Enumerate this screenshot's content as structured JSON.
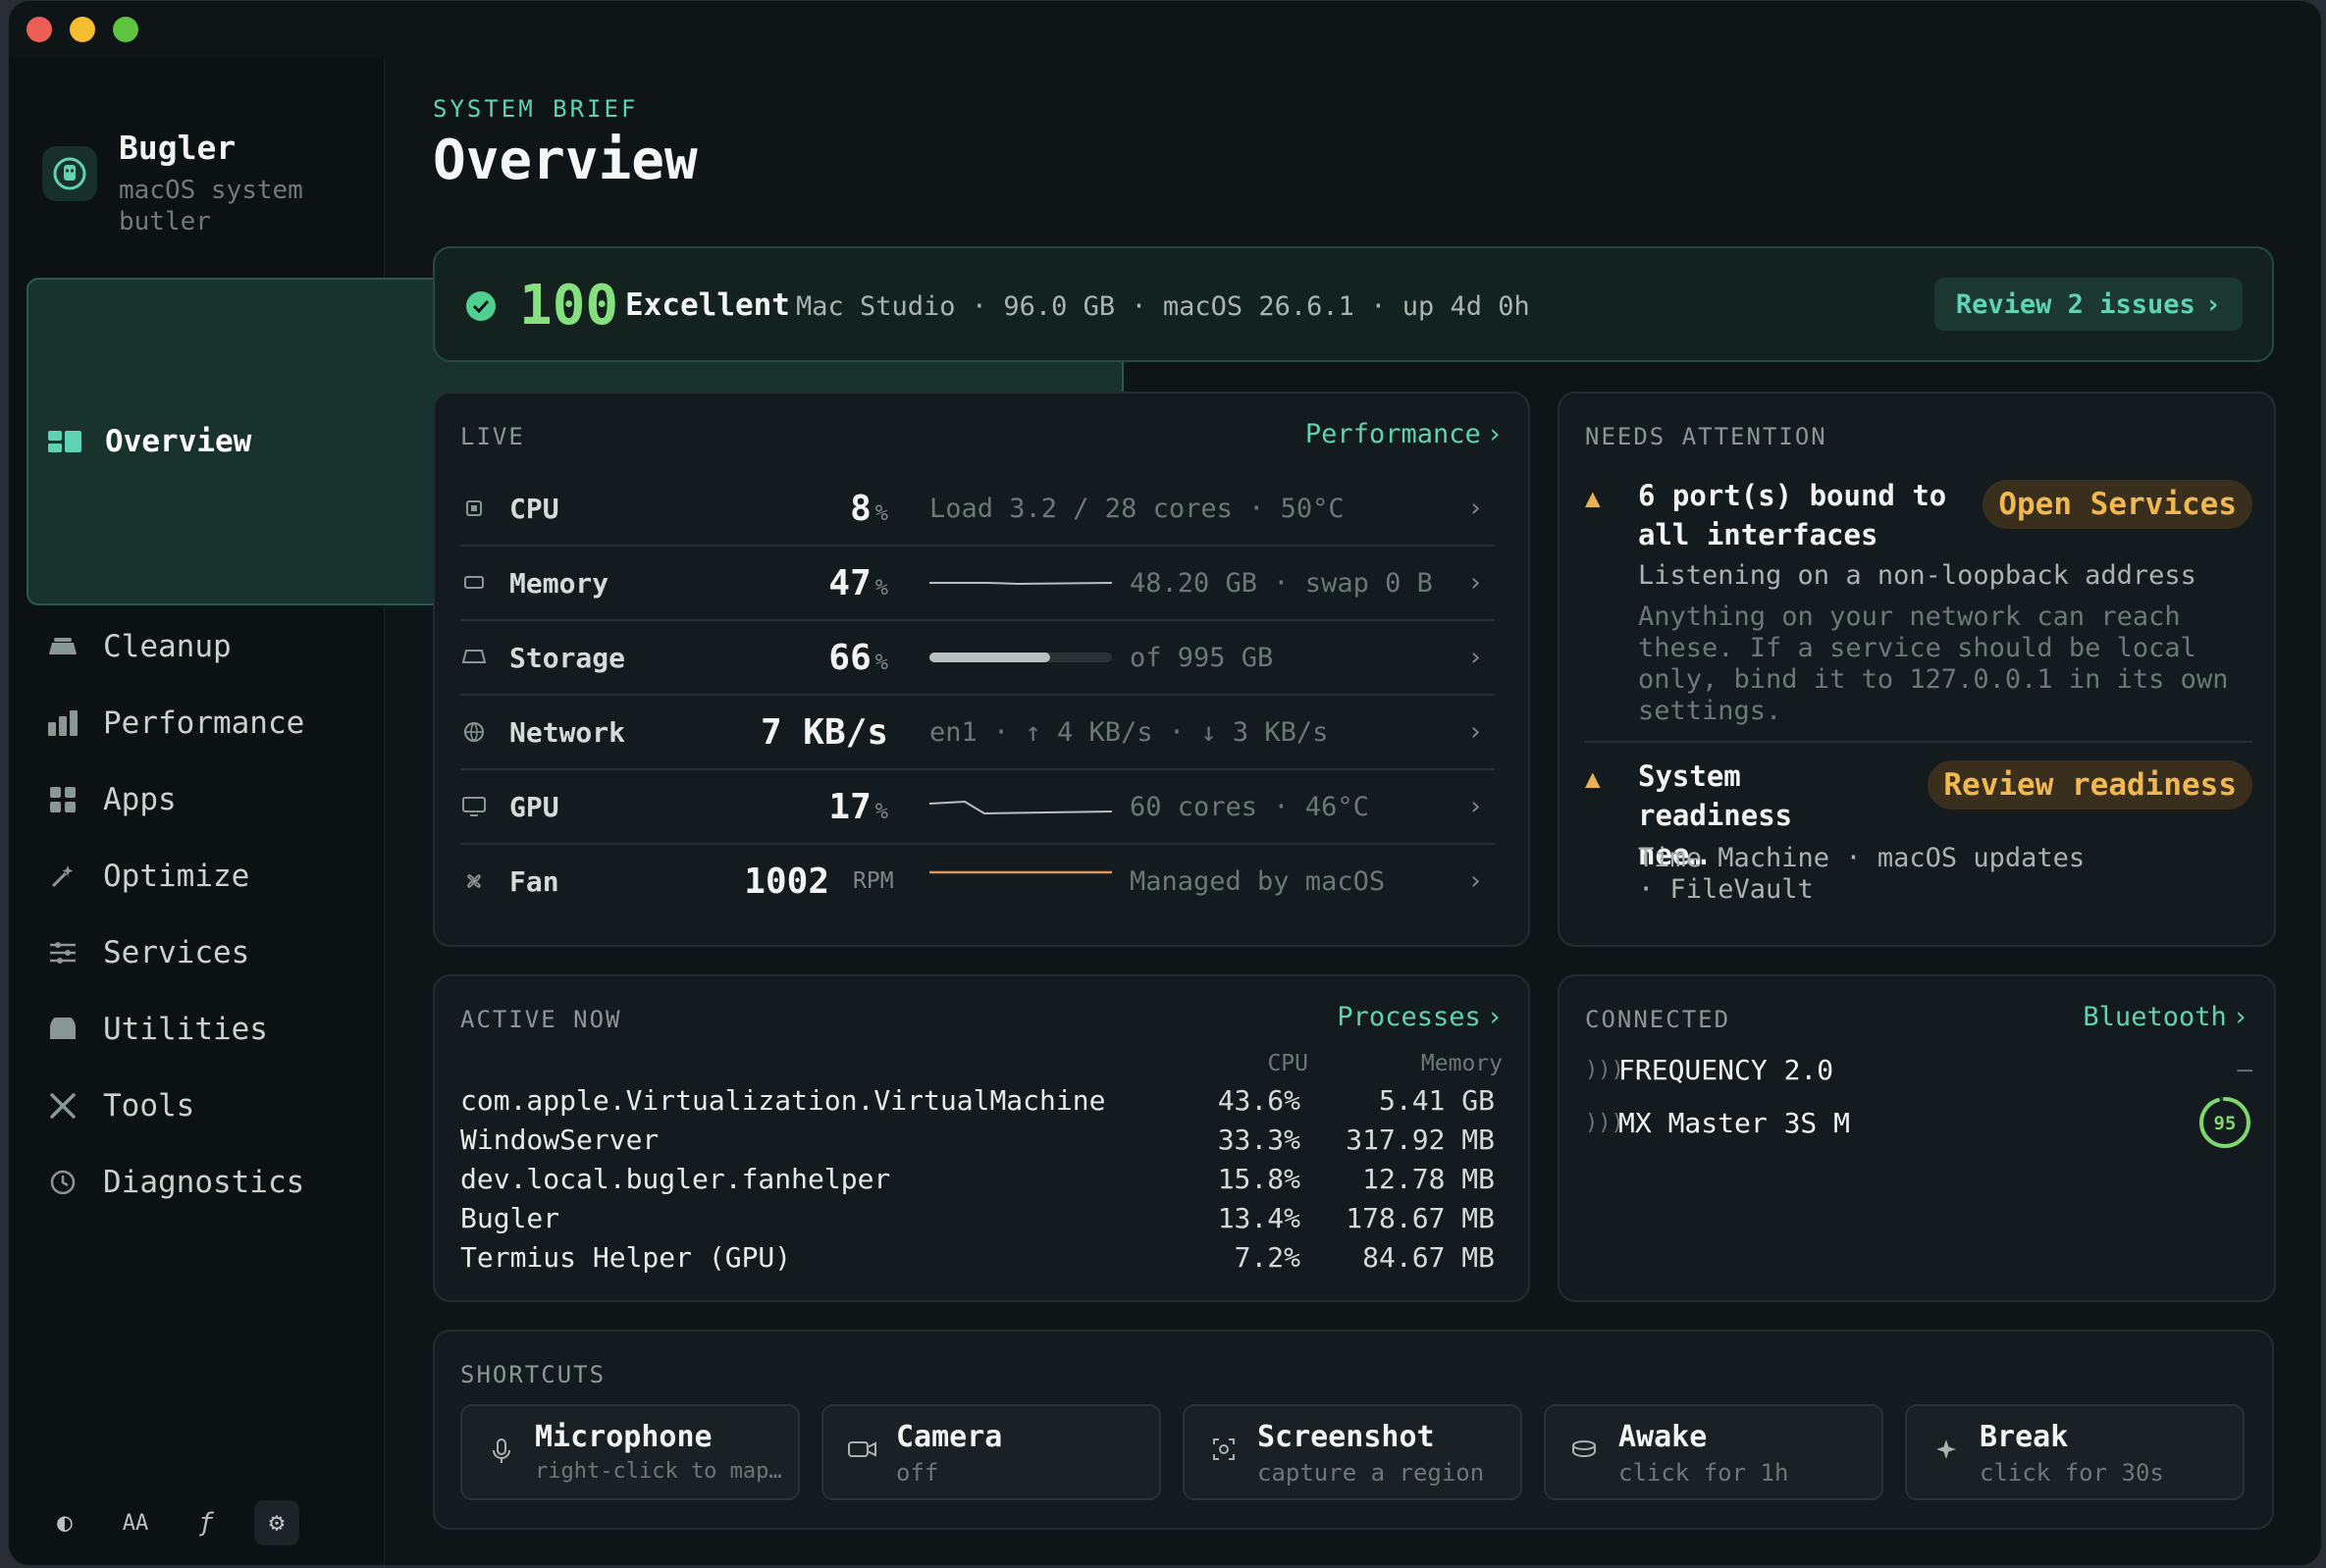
{
  "app": {
    "name": "Bugler",
    "subtitle_line1": "macOS system",
    "subtitle_line2": "butler"
  },
  "nav": [
    {
      "label": "Overview",
      "icon": "overview-icon",
      "active": true
    },
    {
      "label": "Cleanup",
      "icon": "cleanup-icon"
    },
    {
      "label": "Performance",
      "icon": "performance-icon"
    },
    {
      "label": "Apps",
      "icon": "apps-icon"
    },
    {
      "label": "Optimize",
      "icon": "optimize-icon"
    },
    {
      "label": "Services",
      "icon": "services-icon"
    },
    {
      "label": "Utilities",
      "icon": "utilities-icon"
    },
    {
      "label": "Tools",
      "icon": "tools-icon"
    },
    {
      "label": "Diagnostics",
      "icon": "diagnostics-icon"
    }
  ],
  "sidebar_footer": [
    "contrast-icon",
    "text-size-icon",
    "function-icon",
    "gear-icon"
  ],
  "header": {
    "eyebrow": "SYSTEM BRIEF",
    "title": "Overview"
  },
  "health": {
    "score": "100",
    "grade": "Excellent",
    "meta": "Mac Studio · 96.0 GB · macOS 26.6.1 · up 4d 0h",
    "action": "Review 2 issues",
    "score_color": "#86e07f"
  },
  "live": {
    "label": "LIVE",
    "link": "Performance",
    "metrics": [
      {
        "name": "CPU",
        "value": "8",
        "unit": "%",
        "detail": "Load 3.2 / 28 cores · 50°C"
      },
      {
        "name": "Memory",
        "value": "47",
        "unit": "%",
        "detail": "48.20 GB · swap 0 B"
      },
      {
        "name": "Storage",
        "value": "66",
        "unit": "%",
        "detail": "of 995 GB",
        "fill": 0.66
      },
      {
        "name": "Network",
        "value": "7 KB/s",
        "unit": "",
        "detail": "en1 · ↑ 4 KB/s · ↓ 3 KB/s"
      },
      {
        "name": "GPU",
        "value": "17",
        "unit": "%",
        "detail": "60 cores · 46°C"
      },
      {
        "name": "Fan",
        "value": "1002",
        "unit": "RPM",
        "detail": "Managed by macOS"
      }
    ]
  },
  "attention": {
    "label": "NEEDS ATTENTION",
    "items": [
      {
        "title": "6 port(s) bound to all interfaces",
        "action": "Open Services",
        "subtitle": "Listening on a non-loopback address",
        "description": "Anything on your network can reach these. If a service should be local only, bind it to 127.0.0.1 in its own settings."
      },
      {
        "title": "System readiness nee…",
        "action": "Review readiness",
        "subtitle": "Time Machine · macOS updates · FileVault"
      }
    ],
    "warn_color": "#e7b256"
  },
  "active": {
    "label": "ACTIVE NOW",
    "link": "Processes",
    "col_cpu": "CPU",
    "col_mem": "Memory",
    "processes": [
      {
        "name": "com.apple.Virtualization.VirtualMachine",
        "cpu": "43.6%",
        "mem": "5.41 GB"
      },
      {
        "name": "WindowServer",
        "cpu": "33.3%",
        "mem": "317.92 MB"
      },
      {
        "name": "dev.local.bugler.fanhelper",
        "cpu": "15.8%",
        "mem": "12.78 MB"
      },
      {
        "name": "Bugler",
        "cpu": "13.4%",
        "mem": "178.67 MB"
      },
      {
        "name": "Termius Helper (GPU)",
        "cpu": "7.2%",
        "mem": "84.67 MB"
      }
    ]
  },
  "connected": {
    "label": "CONNECTED",
    "link": "Bluetooth",
    "devices": [
      {
        "name": "FREQUENCY 2.0",
        "value": "—"
      },
      {
        "name": "MX Master 3S M",
        "battery": "95",
        "battery_level": 0.95
      }
    ]
  },
  "shortcuts": {
    "label": "SHORTCUTS",
    "items": [
      {
        "title": "Microphone",
        "sub": "right-click to map…",
        "icon": "microphone-icon"
      },
      {
        "title": "Camera",
        "sub": "off",
        "icon": "camera-icon"
      },
      {
        "title": "Screenshot",
        "sub": "capture a region",
        "icon": "screenshot-icon"
      },
      {
        "title": "Awake",
        "sub": "click for 1h",
        "icon": "awake-icon"
      },
      {
        "title": "Break",
        "sub": "click for 30s",
        "icon": "break-icon"
      }
    ]
  },
  "accent": "#5fd3b4"
}
